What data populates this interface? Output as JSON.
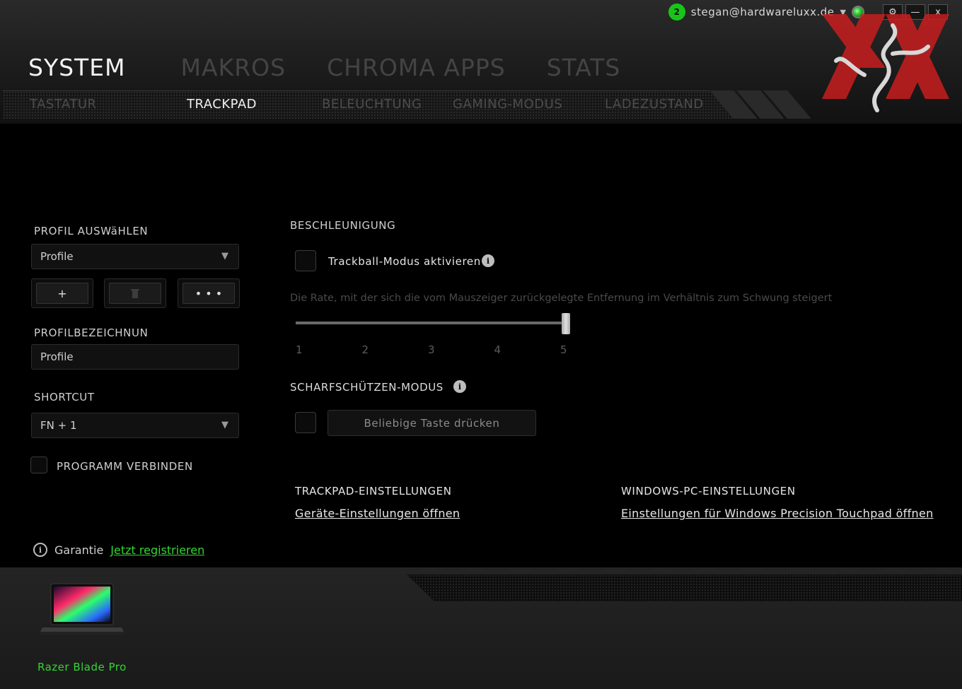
{
  "topbar": {
    "notification_count": "2",
    "user_email": "stegan@hardwareluxx.de",
    "caret": "▼",
    "settings": "⚙",
    "minimize": "—",
    "close": "x"
  },
  "main_tabs": [
    {
      "label": "SYSTEM",
      "active": true
    },
    {
      "label": "MAKROS",
      "active": false
    },
    {
      "label": "CHROMA APPS",
      "active": false
    },
    {
      "label": "STATS",
      "active": false
    }
  ],
  "sub_tabs": [
    {
      "label": "TASTATUR",
      "active": false
    },
    {
      "label": "TRACKPAD",
      "active": true
    },
    {
      "label": "BELEUCHTUNG",
      "active": false
    },
    {
      "label": "GAMING-MODUS",
      "active": false
    },
    {
      "label": "LADEZUSTAND",
      "active": false
    }
  ],
  "left": {
    "profile_select_label": "PROFIL AUSWäHLEN",
    "profile_select_value": "Profile",
    "add_btn": "+",
    "delete_btn": "🗑",
    "more_btn": "• • •",
    "profile_name_label": "PROFILBEZEICHNUN",
    "profile_name_value": "Profile",
    "shortcut_label": "SHORTCUT",
    "shortcut_value": "FN + 1",
    "link_program_label": "PROGRAMM VERBINDEN",
    "dd_arrow": "▼",
    "warranty_label": "Garantie",
    "register_link": "Jetzt registrieren",
    "info": "i"
  },
  "right": {
    "accel_heading": "BESCHLEUNIGUNG",
    "trackball_label": "Trackball-Modus aktivieren",
    "accel_description": "Die Rate, mit der sich die vom Mauszeiger zurückgelegte Entfernung im Verhältnis zum Schwung steigert",
    "slider": {
      "min": 1,
      "max": 5,
      "value": 5,
      "ticks": [
        "1",
        "2",
        "3",
        "4",
        "5"
      ]
    },
    "sniper_heading": "SCHARFSCHÜTZEN-MODUS",
    "sniper_key_placeholder": "Beliebige Taste drücken",
    "trackpad_settings_heading": "TRACKPAD-EINSTELLUNGEN",
    "device_settings_link": "Geräte-Einstellungen öffnen",
    "windows_settings_heading": "WINDOWS-PC-EINSTELLUNGEN",
    "windows_settings_link": "Einstellungen für Windows Precision Touchpad öffnen"
  },
  "footer": {
    "device_name": "Razer Blade Pro"
  },
  "colors": {
    "accent_green": "#33d633",
    "logo_red": "#c81e1e"
  }
}
